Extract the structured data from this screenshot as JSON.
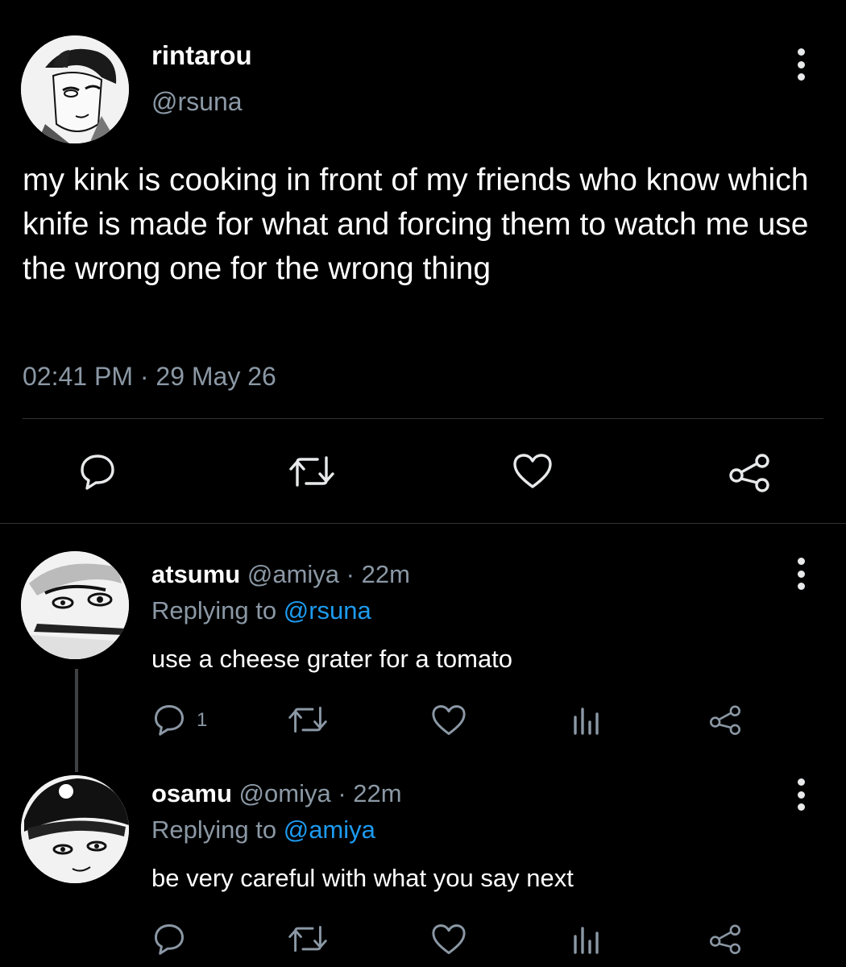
{
  "main_tweet": {
    "display_name": "rintarou",
    "handle": "@rsuna",
    "text": "my kink is cooking in front of my friends who know which knife is made for what and forcing them to watch me use the wrong one for the wrong thing",
    "time": "02:41 PM",
    "separator": "·",
    "date": "29 May 26",
    "actions": [
      "reply-icon",
      "retweet-icon",
      "like-icon",
      "share-icon"
    ]
  },
  "replies": [
    {
      "display_name": "atsumu",
      "handle": "@amiya",
      "sep": "·",
      "time": "22m",
      "replying_prefix": "Replying to",
      "replying_to": "@rsuna",
      "text": "use a cheese grater for a tomato",
      "reply_count": "1"
    },
    {
      "display_name": "osamu",
      "handle": "@omiya",
      "sep": "·",
      "time": "22m",
      "replying_prefix": "Replying to",
      "replying_to": "@amiya",
      "text": "be very careful with what you say next"
    }
  ],
  "colors": {
    "background": "#000000",
    "text": "#ffffff",
    "secondary": "#8b98a5",
    "mention": "#1d9bf0",
    "divider": "#2f3336"
  }
}
